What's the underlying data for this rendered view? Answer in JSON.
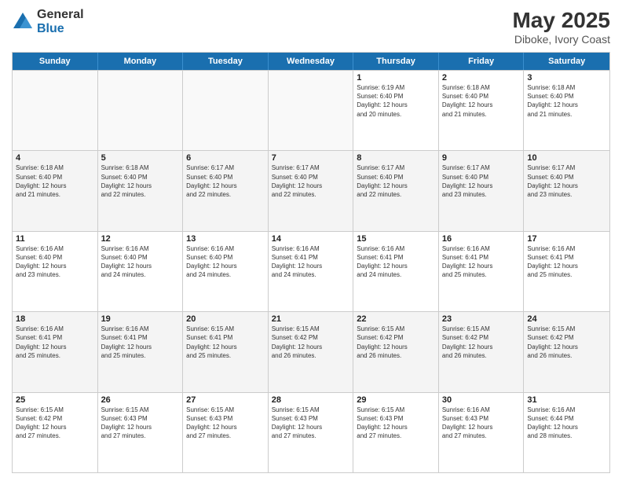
{
  "logo": {
    "general": "General",
    "blue": "Blue"
  },
  "header": {
    "month_year": "May 2025",
    "location": "Diboke, Ivory Coast"
  },
  "days": [
    "Sunday",
    "Monday",
    "Tuesday",
    "Wednesday",
    "Thursday",
    "Friday",
    "Saturday"
  ],
  "weeks": [
    [
      {
        "day": "",
        "text": ""
      },
      {
        "day": "",
        "text": ""
      },
      {
        "day": "",
        "text": ""
      },
      {
        "day": "",
        "text": ""
      },
      {
        "day": "1",
        "text": "Sunrise: 6:19 AM\nSunset: 6:40 PM\nDaylight: 12 hours\nand 20 minutes."
      },
      {
        "day": "2",
        "text": "Sunrise: 6:18 AM\nSunset: 6:40 PM\nDaylight: 12 hours\nand 21 minutes."
      },
      {
        "day": "3",
        "text": "Sunrise: 6:18 AM\nSunset: 6:40 PM\nDaylight: 12 hours\nand 21 minutes."
      }
    ],
    [
      {
        "day": "4",
        "text": "Sunrise: 6:18 AM\nSunset: 6:40 PM\nDaylight: 12 hours\nand 21 minutes."
      },
      {
        "day": "5",
        "text": "Sunrise: 6:18 AM\nSunset: 6:40 PM\nDaylight: 12 hours\nand 22 minutes."
      },
      {
        "day": "6",
        "text": "Sunrise: 6:17 AM\nSunset: 6:40 PM\nDaylight: 12 hours\nand 22 minutes."
      },
      {
        "day": "7",
        "text": "Sunrise: 6:17 AM\nSunset: 6:40 PM\nDaylight: 12 hours\nand 22 minutes."
      },
      {
        "day": "8",
        "text": "Sunrise: 6:17 AM\nSunset: 6:40 PM\nDaylight: 12 hours\nand 22 minutes."
      },
      {
        "day": "9",
        "text": "Sunrise: 6:17 AM\nSunset: 6:40 PM\nDaylight: 12 hours\nand 23 minutes."
      },
      {
        "day": "10",
        "text": "Sunrise: 6:17 AM\nSunset: 6:40 PM\nDaylight: 12 hours\nand 23 minutes."
      }
    ],
    [
      {
        "day": "11",
        "text": "Sunrise: 6:16 AM\nSunset: 6:40 PM\nDaylight: 12 hours\nand 23 minutes."
      },
      {
        "day": "12",
        "text": "Sunrise: 6:16 AM\nSunset: 6:40 PM\nDaylight: 12 hours\nand 24 minutes."
      },
      {
        "day": "13",
        "text": "Sunrise: 6:16 AM\nSunset: 6:40 PM\nDaylight: 12 hours\nand 24 minutes."
      },
      {
        "day": "14",
        "text": "Sunrise: 6:16 AM\nSunset: 6:41 PM\nDaylight: 12 hours\nand 24 minutes."
      },
      {
        "day": "15",
        "text": "Sunrise: 6:16 AM\nSunset: 6:41 PM\nDaylight: 12 hours\nand 24 minutes."
      },
      {
        "day": "16",
        "text": "Sunrise: 6:16 AM\nSunset: 6:41 PM\nDaylight: 12 hours\nand 25 minutes."
      },
      {
        "day": "17",
        "text": "Sunrise: 6:16 AM\nSunset: 6:41 PM\nDaylight: 12 hours\nand 25 minutes."
      }
    ],
    [
      {
        "day": "18",
        "text": "Sunrise: 6:16 AM\nSunset: 6:41 PM\nDaylight: 12 hours\nand 25 minutes."
      },
      {
        "day": "19",
        "text": "Sunrise: 6:16 AM\nSunset: 6:41 PM\nDaylight: 12 hours\nand 25 minutes."
      },
      {
        "day": "20",
        "text": "Sunrise: 6:15 AM\nSunset: 6:41 PM\nDaylight: 12 hours\nand 25 minutes."
      },
      {
        "day": "21",
        "text": "Sunrise: 6:15 AM\nSunset: 6:42 PM\nDaylight: 12 hours\nand 26 minutes."
      },
      {
        "day": "22",
        "text": "Sunrise: 6:15 AM\nSunset: 6:42 PM\nDaylight: 12 hours\nand 26 minutes."
      },
      {
        "day": "23",
        "text": "Sunrise: 6:15 AM\nSunset: 6:42 PM\nDaylight: 12 hours\nand 26 minutes."
      },
      {
        "day": "24",
        "text": "Sunrise: 6:15 AM\nSunset: 6:42 PM\nDaylight: 12 hours\nand 26 minutes."
      }
    ],
    [
      {
        "day": "25",
        "text": "Sunrise: 6:15 AM\nSunset: 6:42 PM\nDaylight: 12 hours\nand 27 minutes."
      },
      {
        "day": "26",
        "text": "Sunrise: 6:15 AM\nSunset: 6:43 PM\nDaylight: 12 hours\nand 27 minutes."
      },
      {
        "day": "27",
        "text": "Sunrise: 6:15 AM\nSunset: 6:43 PM\nDaylight: 12 hours\nand 27 minutes."
      },
      {
        "day": "28",
        "text": "Sunrise: 6:15 AM\nSunset: 6:43 PM\nDaylight: 12 hours\nand 27 minutes."
      },
      {
        "day": "29",
        "text": "Sunrise: 6:15 AM\nSunset: 6:43 PM\nDaylight: 12 hours\nand 27 minutes."
      },
      {
        "day": "30",
        "text": "Sunrise: 6:16 AM\nSunset: 6:43 PM\nDaylight: 12 hours\nand 27 minutes."
      },
      {
        "day": "31",
        "text": "Sunrise: 6:16 AM\nSunset: 6:44 PM\nDaylight: 12 hours\nand 28 minutes."
      }
    ]
  ]
}
